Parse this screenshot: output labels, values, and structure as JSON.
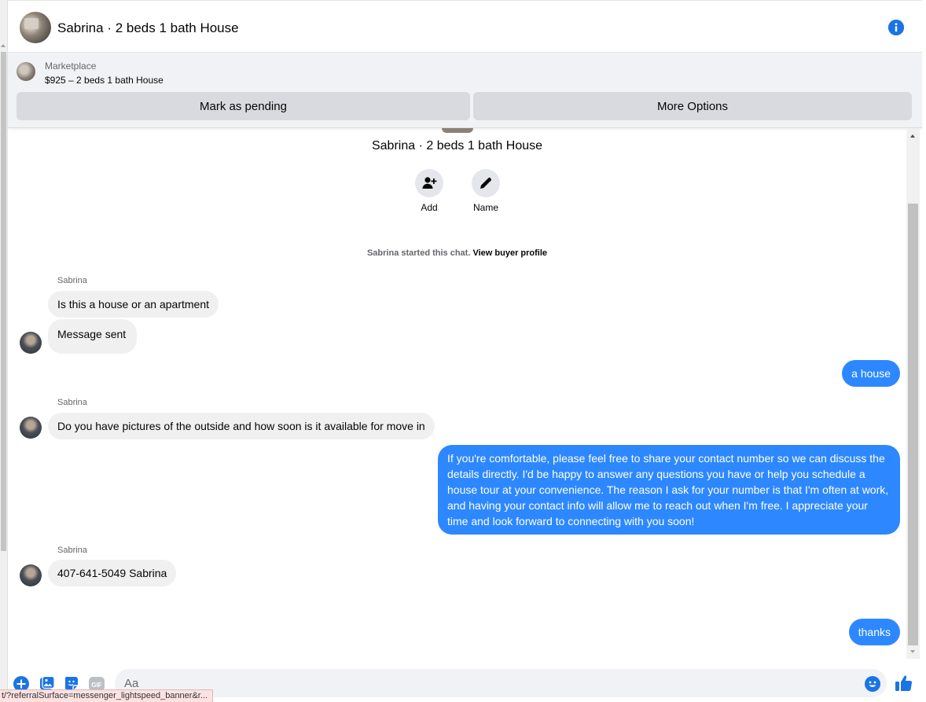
{
  "header": {
    "title": "Sabrina · 2 beds 1 bath House"
  },
  "banner": {
    "label": "Marketplace",
    "listing": "$925 – 2 beds 1 bath House",
    "pending_label": "Mark as pending",
    "more_label": "More Options"
  },
  "chat": {
    "title": "Sabrina · 2 beds 1 bath House",
    "actions": {
      "add_label": "Add",
      "name_label": "Name"
    },
    "started_text": "Sabrina started this chat.",
    "profile_link": "View buyer profile",
    "messages": [
      {
        "sender": "Sabrina",
        "text": "Is this a house or an apartment"
      },
      {
        "text": "Message sent"
      },
      {
        "text": "a house"
      },
      {
        "sender": "Sabrina",
        "text": "Do you have pictures of the outside and how soon is it available for move in"
      },
      {
        "text": "If you're comfortable, please feel free to share your contact number so we can discuss the details directly. I'd be happy to answer any questions you have or help you schedule a house tour at your convenience. The reason I ask for your number is that I'm often at work, and having your contact info will allow me to reach out when I'm free. I appreciate your time and look forward to connecting with you soon!"
      },
      {
        "sender": "Sabrina",
        "text": "407-641-5049 Sabrina"
      },
      {
        "text": "thanks"
      }
    ]
  },
  "composer": {
    "placeholder": "Aa"
  },
  "status_url": "t/?referralSurface=messenger_lightspeed_banner&r...",
  "colors": {
    "accent": "#2d88ff",
    "icon_blue": "#1b74e4",
    "incoming_bubble": "#f0f0f0"
  }
}
